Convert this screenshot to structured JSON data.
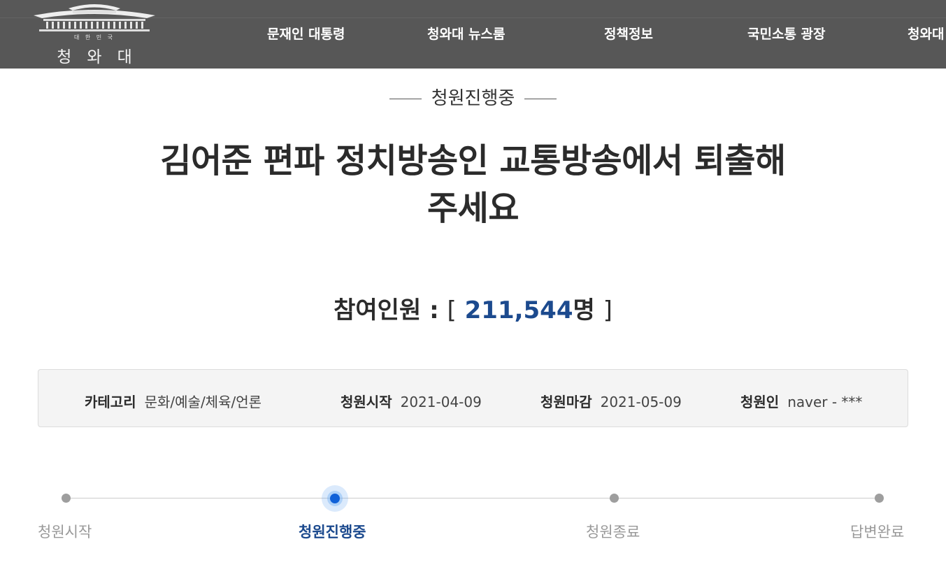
{
  "header": {
    "logo": {
      "subtitle": "대 한 민 국",
      "name": "청와대"
    },
    "nav": [
      {
        "label": "문재인 대통령"
      },
      {
        "label": "청와대 뉴스룸"
      },
      {
        "label": "정책정보"
      },
      {
        "label": "국민소통 광장"
      },
      {
        "label": "청와대"
      }
    ]
  },
  "petition": {
    "status_heading": "청원진행중",
    "title_line1": "김어준 편파 정치방송인 교통방송에서 퇴출해",
    "title_line2": "주세요",
    "participants": {
      "label": "참여인원 :",
      "open_bracket": "[",
      "count": "211,544",
      "unit": "명",
      "close_bracket": "]"
    },
    "info": [
      {
        "label": "카테고리",
        "value": "문화/예술/체육/언론"
      },
      {
        "label": "청원시작",
        "value": "2021-04-09"
      },
      {
        "label": "청원마감",
        "value": "2021-05-09"
      },
      {
        "label": "청원인",
        "value": "naver - ***"
      }
    ],
    "progress": {
      "steps": [
        {
          "label": "청원시작",
          "active": false
        },
        {
          "label": "청원진행중",
          "active": true
        },
        {
          "label": "청원종료",
          "active": false
        },
        {
          "label": "답변완료",
          "active": false
        }
      ]
    }
  },
  "colors": {
    "header_bg": "#575757",
    "accent": "#1c4a8e",
    "active_dot": "#1061d8"
  }
}
